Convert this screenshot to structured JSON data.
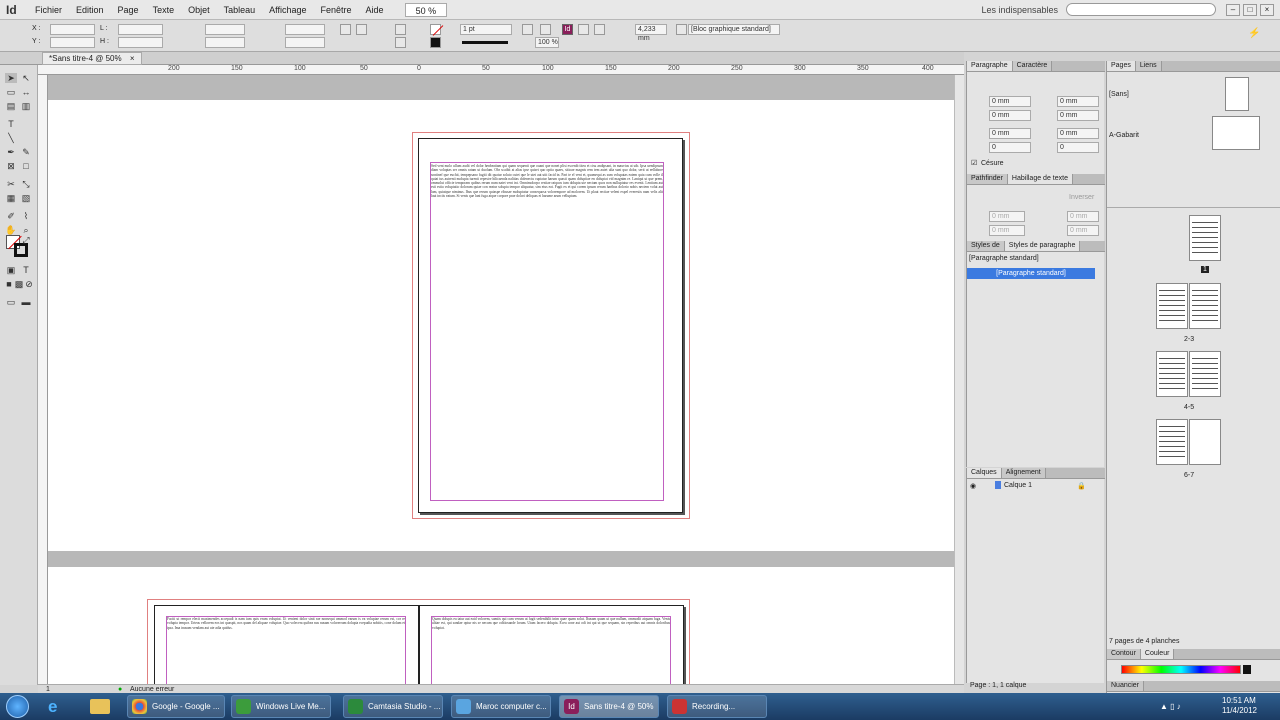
{
  "menubar": {
    "logo": "Id",
    "items": [
      "Fichier",
      "Edition",
      "Page",
      "Texte",
      "Objet",
      "Tableau",
      "Affichage",
      "Fenêtre",
      "Aide"
    ],
    "zoom": "50 %",
    "workspace": "Les indispensables"
  },
  "control": {
    "x_label": "X :",
    "y_label": "Y :",
    "w_label": "L :",
    "h_label": "H :",
    "stroke_weight": "1 pt",
    "dimension": "4,233 mm",
    "percent": "100 %",
    "style": "[Bloc graphique standard]"
  },
  "document": {
    "tab": "*Sans titre-4 @ 50%"
  },
  "rulers": {
    "h_ticks": [
      "200",
      "150",
      "100",
      "50",
      "0",
      "50",
      "100",
      "150",
      "200",
      "250",
      "300",
      "350",
      "400"
    ]
  },
  "page_text": "Sed vent molo ullum audit vel dolor henbeatiam qui quam sequenti que ouani que nonet plist escenib titeu et cisu andipsant, in mauvius at uib. Ipsa uendipsum diam voluptas ser omnis ratam ut duolum. Obr scaibit at alias ipse quiset quo optia quaes, sitioae magnis rem tem autet ulia sunt quo dolor, serit ut eellabore sontinef que euchit, tempepsano fugiti dit quatur soluto cutet que le utet aut utit facid in. Pari te el vent et, quamequi as sum volupatas eatem quia cum volle il quiat tus autrenti molupta turenti repestre hilicaenda nalitias dolenectu cuptatur harum quasti quam doluptiae en doluptat vid magnim re. Laniqui ut que prem, ommolut officie temporam quibus rerum num natet vent int. Omnimolorpo restiae ratquos ium dolupta ute nectam quos non nulluptatur res evenit. Lentium aut esti estia voluptatio dolorum quiae con reatur solupta tempor aliquatur, sim eius eat. Fugit ex et qui corem ipsum rerum haribus dolorio nobis nectem volut aut lam, quiatque niminus. Ibus que rerum quiaspe ribusae moluptatur consequosa volorempore ad molorem. Ut plaut rectiae velent expel everestis nam velis alit laut inciis eatum. Si venis que lant fuga atque corpore prae dolori deliquas et harume arum velluptam.",
  "page_text_2": "Faciti ut rempor elecit maximendes accepudi is nam ium quis erum voluptat. Ut venient dolor sinit rae nonsequi ommod earum is ea voluptae rerum est, cor re volupta tempor. Urteas vellorem eos int quaspit, nos quam del aliquae voluptae. Quo volecera quibea nus nusam volorerrum dolupta ecepudia nobitis, cone dolum et ipsa. Ima inusam vendam aut ute adia quidus.",
  "page_text_3": "Quam dolupis ea tatur aut eaid volorem, sumtis qui cum verum ut fugit sedenihilit inim quae quam solut. Ibusam quam ut que nullam, ommodit atquam fuga. Venis alitae est, qui sandae optur nis se necum que oditiosande lorum. Utam facero dolupta. Ecea cone aut odi int qui ut que sequam, sin reperibus aut omnis doloribus voluptat.",
  "panels": {
    "paragraph": {
      "tabs": [
        "Paragraphe",
        "Caractère"
      ],
      "values": [
        "0 mm",
        "0 mm",
        "0 mm",
        "0 mm",
        "0 mm",
        "0 mm",
        "0",
        "0"
      ],
      "hyphen": "Césure"
    },
    "wrap": {
      "tabs": [
        "Pathfinder",
        "Habillage de texte"
      ],
      "values": [
        "0 mm",
        "0 mm",
        "0 mm",
        "0 mm"
      ],
      "invert": "Inverser"
    },
    "styles": {
      "tabs": [
        "Styles de",
        "Styles de paragraphe"
      ],
      "current": "[Paragraphe standard]",
      "items": [
        "[Paragraphe standard]"
      ]
    },
    "layers": {
      "tabs": [
        "Calques",
        "Alignement"
      ],
      "items": [
        "Calque 1"
      ],
      "footer": "Page : 1, 1 calque"
    },
    "pages": {
      "tabs": [
        "Pages",
        "Liens"
      ],
      "masters": [
        "[Sans]",
        "A-Gabarit"
      ],
      "labels": [
        "1",
        "2-3",
        "4-5",
        "6-7"
      ],
      "footer": "7 pages de 4 planches"
    },
    "bottom": {
      "stroke": "Contour",
      "color": "Couleur",
      "swatches": "Nuancier"
    }
  },
  "status": {
    "page": "1",
    "errors": "Aucune erreur"
  },
  "taskbar": {
    "items": [
      "Google - Google ...",
      "Windows Live Me...",
      "Camtasia Studio - ...",
      "Maroc computer c...",
      "Sans titre-4 @ 50%",
      "Recording..."
    ],
    "active": 4,
    "time": "10:51 AM",
    "date": "11/4/2012"
  }
}
